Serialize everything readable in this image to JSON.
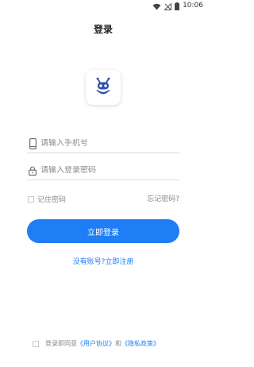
{
  "status_bar": {
    "time": "10:06",
    "icons": [
      "wifi-icon",
      "signal-off-icon",
      "battery-icon"
    ]
  },
  "page": {
    "title": "登录"
  },
  "logo": {
    "icon": "robot-logo-icon",
    "color": "#2f4fa8"
  },
  "form": {
    "phone": {
      "placeholder": "请输入手机号",
      "value": "",
      "icon": "phone-icon"
    },
    "password": {
      "placeholder": "请输入登录密码",
      "value": "",
      "icon": "lock-icon"
    },
    "remember_label": "记住密码",
    "forgot_label": "忘记密码?",
    "login_button": "立即登录",
    "register_link": "没有账号?立即注册"
  },
  "agreement": {
    "prefix": "登录即同意",
    "user_agreement": "《用户协议》",
    "conjunction": "和",
    "privacy_policy": "《隐私政策》"
  },
  "colors": {
    "accent": "#1f7df5",
    "muted_text": "#888888"
  }
}
